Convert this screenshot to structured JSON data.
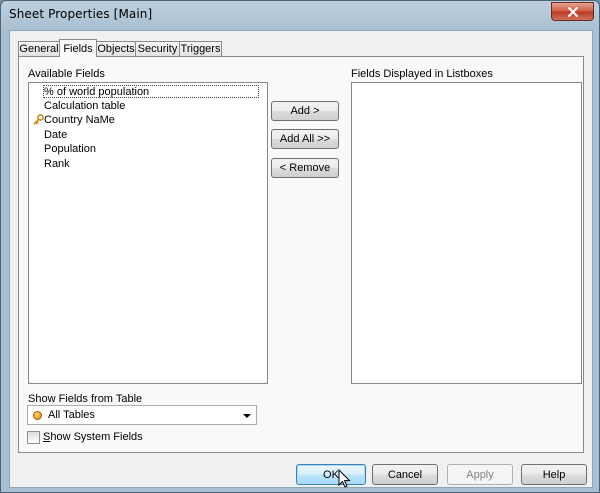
{
  "window": {
    "title": "Sheet Properties [Main]"
  },
  "tabs": [
    {
      "label": "General",
      "active": false
    },
    {
      "label": "Fields",
      "active": true
    },
    {
      "label": "Objects",
      "active": false
    },
    {
      "label": "Security",
      "active": false
    },
    {
      "label": "Triggers",
      "active": false
    }
  ],
  "available_fields": {
    "label": "Available Fields",
    "items": [
      {
        "label": "% of world population",
        "selected": true,
        "icon": ""
      },
      {
        "label": "Calculation table",
        "selected": false,
        "icon": ""
      },
      {
        "label": "Country NaMe",
        "selected": false,
        "icon": "key-icon"
      },
      {
        "label": "Date",
        "selected": false,
        "icon": ""
      },
      {
        "label": "Population",
        "selected": false,
        "icon": ""
      },
      {
        "label": "Rank",
        "selected": false,
        "icon": ""
      }
    ]
  },
  "displayed_fields": {
    "label": "Fields Displayed in Listboxes",
    "items": []
  },
  "transfer_buttons": {
    "add": "Add >",
    "add_all": "Add All >>",
    "remove": "< Remove"
  },
  "show_fields": {
    "label": "Show Fields from Table",
    "selected": "All Tables"
  },
  "system_fields": {
    "label": "Show System Fields",
    "checked": false
  },
  "footer": {
    "ok": "OK",
    "cancel": "Cancel",
    "apply": "Apply",
    "help": "Help"
  },
  "colors": {
    "title_gradient": "#bcd0df",
    "close_button": "#c94a2e",
    "panel_bg": "#f9f9f9",
    "default_button_border": "#3c7fb1"
  }
}
